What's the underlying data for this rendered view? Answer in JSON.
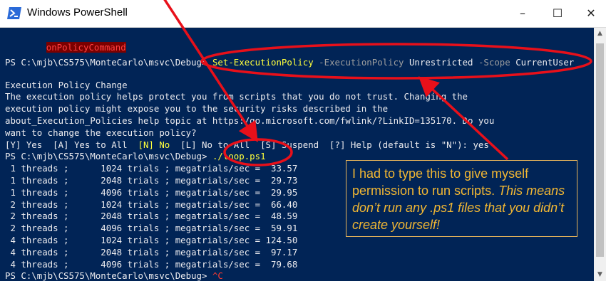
{
  "window": {
    "title": "Windows PowerShell",
    "controls": {
      "minimize": "–",
      "maximize": "☐",
      "close": "✕"
    }
  },
  "terminal": {
    "top_cut": "onPolicyCommand",
    "cmd1": {
      "prompt": "PS C:\\mjb\\CS575\\MonteCarlo\\msvc\\Debug> ",
      "cmdlet": "Set-ExecutionPolicy",
      "param1": " -ExecutionPolicy ",
      "value1": "Unrestricted",
      "param2": " -Scope ",
      "value2": "CurrentUser"
    },
    "policy_lines": [
      "Execution Policy Change",
      "The execution policy helps protect you from scripts that you do not trust. Changing the",
      "execution policy might expose you to the security risks described in the",
      "about_Execution_Policies help topic at https:/go.microsoft.com/fwlink/?LinkID=135170. Do you",
      "want to change the execution policy?"
    ],
    "choice": {
      "part1": "[Y] Yes  [A] Yes to All  ",
      "no": "[N] No",
      "part2": "  [L] No to All  [S] Suspend  [?] Help (default is \"N\"): yes"
    },
    "cmd2": {
      "prompt": "PS C:\\mjb\\CS575\\MonteCarlo\\msvc\\Debug> ",
      "script": "./loop.ps1"
    },
    "results": [
      " 1 threads ;      1024 trials ; megatrials/sec =  33.57",
      " 1 threads ;      2048 trials ; megatrials/sec =  29.73",
      " 1 threads ;      4096 trials ; megatrials/sec =  29.95",
      " 2 threads ;      1024 trials ; megatrials/sec =  66.40",
      " 2 threads ;      2048 trials ; megatrials/sec =  48.59",
      " 2 threads ;      4096 trials ; megatrials/sec =  59.91",
      " 4 threads ;      1024 trials ; megatrials/sec = 124.50",
      " 4 threads ;      2048 trials ; megatrials/sec =  97.17",
      " 4 threads ;      4096 trials ; megatrials/sec =  79.68"
    ],
    "cmd3": {
      "prompt": "PS C:\\mjb\\CS575\\MonteCarlo\\msvc\\Debug> ",
      "ctrl": "^C"
    }
  },
  "callout": {
    "normal": "I had to type this to give myself permission to run scripts.  ",
    "italic": "This means don’t run any .ps1 files that you didn’t create yourself!"
  },
  "colors": {
    "terminal_bg": "#012456",
    "annotation": "#e8101a",
    "callout_text": "#f2b733",
    "prompt_text": "#eeedf0",
    "cmdlet": "#ffff3c"
  }
}
